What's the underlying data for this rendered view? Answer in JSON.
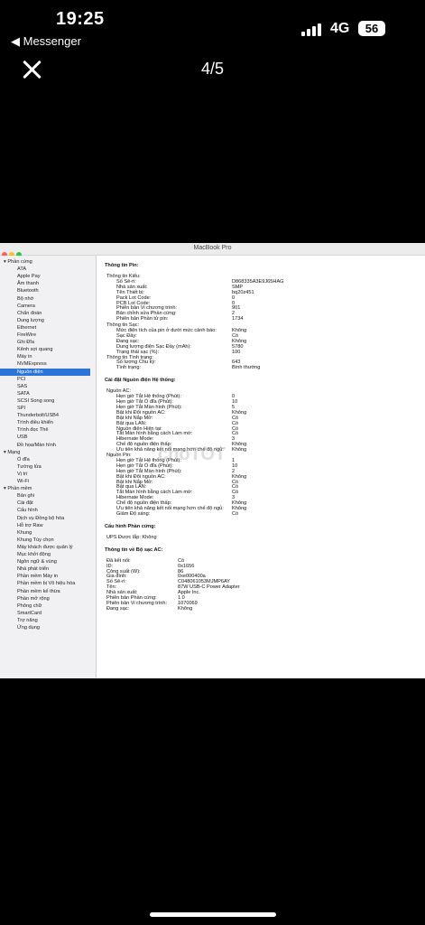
{
  "status": {
    "time": "19:25",
    "back_app": "◀ Messenger",
    "network": "4G",
    "battery": "56"
  },
  "viewer": {
    "counter": "4/5"
  },
  "window": {
    "title": "MacBook Pro",
    "watermark": "choTOT"
  },
  "sidebar": {
    "items": [
      {
        "label": "▾ Phần cứng",
        "indent": 0
      },
      {
        "label": "ATA",
        "indent": 1
      },
      {
        "label": "Apple Pay",
        "indent": 1
      },
      {
        "label": "Âm thanh",
        "indent": 1
      },
      {
        "label": "Bluetooth",
        "indent": 1
      },
      {
        "label": "Bộ nhớ",
        "indent": 1
      },
      {
        "label": "Camera",
        "indent": 1
      },
      {
        "label": "Chẩn đoán",
        "indent": 1
      },
      {
        "label": "Dung lượng",
        "indent": 1
      },
      {
        "label": "Ethernet",
        "indent": 1
      },
      {
        "label": "FireWire",
        "indent": 1
      },
      {
        "label": "Ghi Đĩa",
        "indent": 1
      },
      {
        "label": "Kênh sợi quang",
        "indent": 1
      },
      {
        "label": "Máy in",
        "indent": 1
      },
      {
        "label": "NVMExpress",
        "indent": 1
      },
      {
        "label": "Nguồn điện",
        "indent": 1,
        "selected": true
      },
      {
        "label": "PCI",
        "indent": 1
      },
      {
        "label": "SAS",
        "indent": 1
      },
      {
        "label": "SATA",
        "indent": 1
      },
      {
        "label": "SCSI Song song",
        "indent": 1
      },
      {
        "label": "SPI",
        "indent": 1
      },
      {
        "label": "Thunderbolt/USB4",
        "indent": 1
      },
      {
        "label": "Trình điều khiển",
        "indent": 1
      },
      {
        "label": "Trình đọc Thẻ",
        "indent": 1
      },
      {
        "label": "USB",
        "indent": 1
      },
      {
        "label": "Đồ họa/Màn hình",
        "indent": 1
      },
      {
        "label": "▾ Mạng",
        "indent": 0
      },
      {
        "label": "Ổ đĩa",
        "indent": 1
      },
      {
        "label": "Tường lửa",
        "indent": 1
      },
      {
        "label": "Vị trí",
        "indent": 1
      },
      {
        "label": "Wi-Fi",
        "indent": 1
      },
      {
        "label": "▾ Phần mềm",
        "indent": 0
      },
      {
        "label": "Bản ghi",
        "indent": 1
      },
      {
        "label": "Cài đặt",
        "indent": 1
      },
      {
        "label": "Cấu hình",
        "indent": 1
      },
      {
        "label": "Dịch vụ Đồng bộ hóa",
        "indent": 1
      },
      {
        "label": "Hỗ trợ Raw",
        "indent": 1
      },
      {
        "label": "Khung",
        "indent": 1
      },
      {
        "label": "Khung Tùy chọn",
        "indent": 1
      },
      {
        "label": "Máy khách được quản lý",
        "indent": 1
      },
      {
        "label": "Mục khởi động",
        "indent": 1
      },
      {
        "label": "Ngôn ngữ & vùng",
        "indent": 1
      },
      {
        "label": "Nhà phát triển",
        "indent": 1
      },
      {
        "label": "Phần mềm Máy in",
        "indent": 1
      },
      {
        "label": "Phần mềm bị Vô hiệu hóa",
        "indent": 1
      },
      {
        "label": "Phần mềm kế thừa",
        "indent": 1
      },
      {
        "label": "Phần mở rộng",
        "indent": 1
      },
      {
        "label": "Phông chữ",
        "indent": 1
      },
      {
        "label": "SmartCard",
        "indent": 1
      },
      {
        "label": "Trợ năng",
        "indent": 1
      },
      {
        "label": "Ứng dụng",
        "indent": 1
      }
    ]
  },
  "content": {
    "lines": [
      {
        "t": "Thông tin Pin:",
        "h": true,
        "x": 0,
        "v": ""
      },
      {
        "t": "Thông tin Kiểu:",
        "x": 1,
        "v": ""
      },
      {
        "t": "Số Sê-ri:",
        "x": 2,
        "v": "D868335A3E9J65HAG"
      },
      {
        "t": "Nhà sản xuất:",
        "x": 2,
        "v": "SMP"
      },
      {
        "t": "Tên Thiết bị:",
        "x": 2,
        "v": "bq20z451"
      },
      {
        "t": "Pack Lot Code:",
        "x": 2,
        "v": "0"
      },
      {
        "t": "PCB Lot Code:",
        "x": 2,
        "v": "0"
      },
      {
        "t": "Phiên bản Vi chương trình:",
        "x": 2,
        "v": "901"
      },
      {
        "t": "Bản chỉnh sửa Phần cứng:",
        "x": 2,
        "v": "2"
      },
      {
        "t": "Phiên bản Phần tử pin:",
        "x": 2,
        "v": "1734"
      },
      {
        "t": "Thông tin Sạc:",
        "x": 1,
        "v": ""
      },
      {
        "t": "Mức điện tích của pin ở dưới mức cảnh báo:",
        "x": 2,
        "v": "Không"
      },
      {
        "t": "Sạc Đầy:",
        "x": 2,
        "v": "Có"
      },
      {
        "t": "Đang sạc:",
        "x": 2,
        "v": "Không"
      },
      {
        "t": "Dung lượng điện Sạc Đầy (mAh):",
        "x": 2,
        "v": "5780"
      },
      {
        "t": "Trạng thái sạc (%):",
        "x": 2,
        "v": "100"
      },
      {
        "t": "Thông tin Tình trạng:",
        "x": 1,
        "v": ""
      },
      {
        "t": "Số lượng Chu kỳ:",
        "x": 2,
        "v": "643"
      },
      {
        "t": "Tình trạng:",
        "x": 2,
        "v": "Bình thường"
      },
      {
        "t": "Cài đặt Nguồn điện Hệ thống:",
        "h": true,
        "x": 0,
        "v": ""
      },
      {
        "t": "Nguồn AC:",
        "x": 1,
        "v": ""
      },
      {
        "t": "Hẹn giờ Tắt Hệ thống (Phút):",
        "x": 2,
        "v": "0"
      },
      {
        "t": "Hẹn giờ Tắt Ổ đĩa (Phút):",
        "x": 2,
        "v": "10"
      },
      {
        "t": "Hẹn giờ Tắt Màn hình (Phút):",
        "x": 2,
        "v": "5"
      },
      {
        "t": "Bật khi Đổi nguồn AC:",
        "x": 2,
        "v": "Không"
      },
      {
        "t": "Bật khi Nắp Mở:",
        "x": 2,
        "v": "Có"
      },
      {
        "t": "Bật qua LAN:",
        "x": 2,
        "v": "Có"
      },
      {
        "t": "Nguồn điện Hiện tại:",
        "x": 2,
        "v": "Có"
      },
      {
        "t": "Tắt Màn hình bằng cách Làm mờ:",
        "x": 2,
        "v": "Có"
      },
      {
        "t": "Hibernate Mode:",
        "x": 2,
        "v": "3"
      },
      {
        "t": "Chế độ nguồn điện thấp:",
        "x": 2,
        "v": "Không"
      },
      {
        "t": "Ưu tiên khả năng kết nối mạng hơn chế độ ngủ:",
        "x": 2,
        "v": "Không"
      },
      {
        "t": "Nguồn Pin:",
        "x": 1,
        "v": ""
      },
      {
        "t": "Hẹn giờ Tắt Hệ thống (Phút):",
        "x": 2,
        "v": "1"
      },
      {
        "t": "Hẹn giờ Tắt Ổ đĩa (Phút):",
        "x": 2,
        "v": "10"
      },
      {
        "t": "Hẹn giờ Tắt Màn hình (Phút):",
        "x": 2,
        "v": "2"
      },
      {
        "t": "Bật khi Đổi nguồn AC:",
        "x": 2,
        "v": "Không"
      },
      {
        "t": "Bật khi Nắp Mở:",
        "x": 2,
        "v": "Có"
      },
      {
        "t": "Bật qua LAN:",
        "x": 2,
        "v": "Có"
      },
      {
        "t": "Tắt Màn hình bằng cách Làm mờ:",
        "x": 2,
        "v": "Có"
      },
      {
        "t": "Hibernate Mode:",
        "x": 2,
        "v": "3"
      },
      {
        "t": "Chế độ nguồn điện thấp:",
        "x": 2,
        "v": "Không"
      },
      {
        "t": "Ưu tiên khả năng kết nối mạng hơn chế độ ngủ:",
        "x": 2,
        "v": "Không"
      },
      {
        "t": "Giảm Độ sáng:",
        "x": 2,
        "v": "Có"
      },
      {
        "t": "Cấu hình Phần cứng:",
        "h": true,
        "x": 0,
        "v": ""
      },
      {
        "t": "UPS Được lắp:  Không",
        "x": 1,
        "v": ""
      },
      {
        "t": "Thông tin về Bộ sạc AC:",
        "h": true,
        "x": 0,
        "v": ""
      },
      {
        "t": "Đã kết nối:",
        "x": 1,
        "v": "Có"
      },
      {
        "t": "ID:",
        "x": 1,
        "v": "0x1656"
      },
      {
        "t": "Công suất (W):",
        "x": 1,
        "v": "86"
      },
      {
        "t": "Gia đình:",
        "x": 1,
        "v": "0xe000400a"
      },
      {
        "t": "Số Sê-ri:",
        "x": 1,
        "v": "C048061053MJMP6AY"
      },
      {
        "t": "Tên:",
        "x": 1,
        "v": "87W USB-C Power Adapter"
      },
      {
        "t": "Nhà sản xuất:",
        "x": 1,
        "v": "Apple Inc."
      },
      {
        "t": "Phiên bản Phần cứng:",
        "x": 1,
        "v": "1.0"
      },
      {
        "t": "Phiên bản Vi chương trình:",
        "x": 1,
        "v": "1070069"
      },
      {
        "t": "Đang sạc:",
        "x": 1,
        "v": "Không"
      }
    ]
  }
}
